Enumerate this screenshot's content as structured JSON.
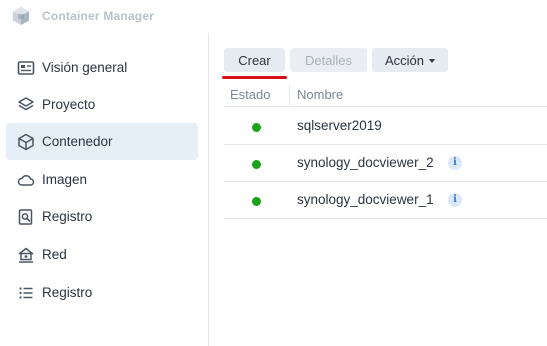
{
  "app": {
    "title": "Container Manager",
    "icon": "container-manager-logo-icon"
  },
  "sidebar": {
    "items": [
      {
        "label": "Visión general",
        "icon": "overview-icon",
        "active": false
      },
      {
        "label": "Proyecto",
        "icon": "project-layers-icon",
        "active": false
      },
      {
        "label": "Contenedor",
        "icon": "container-cube-icon",
        "active": true
      },
      {
        "label": "Imagen",
        "icon": "image-cloud-icon",
        "active": false
      },
      {
        "label": "Registro",
        "icon": "registry-search-icon",
        "active": false
      },
      {
        "label": "Red",
        "icon": "network-icon",
        "active": false
      },
      {
        "label": "Registro",
        "icon": "log-list-icon",
        "active": false
      }
    ]
  },
  "toolbar": {
    "create_label": "Crear",
    "details_label": "Detalles",
    "action_label": "Acción"
  },
  "table": {
    "columns": [
      "Estado",
      "Nombre"
    ],
    "rows": [
      {
        "status": "running",
        "name": "sqlserver2019",
        "info": false
      },
      {
        "status": "running",
        "name": "synology_docviewer_2",
        "info": true
      },
      {
        "status": "running",
        "name": "synology_docviewer_1",
        "info": true
      }
    ]
  },
  "colors": {
    "accent_active_bg": "#e6eef8",
    "status_running": "#1aa31a",
    "highlight_underline": "#d8101c",
    "info_icon": "#3a7bd5"
  }
}
